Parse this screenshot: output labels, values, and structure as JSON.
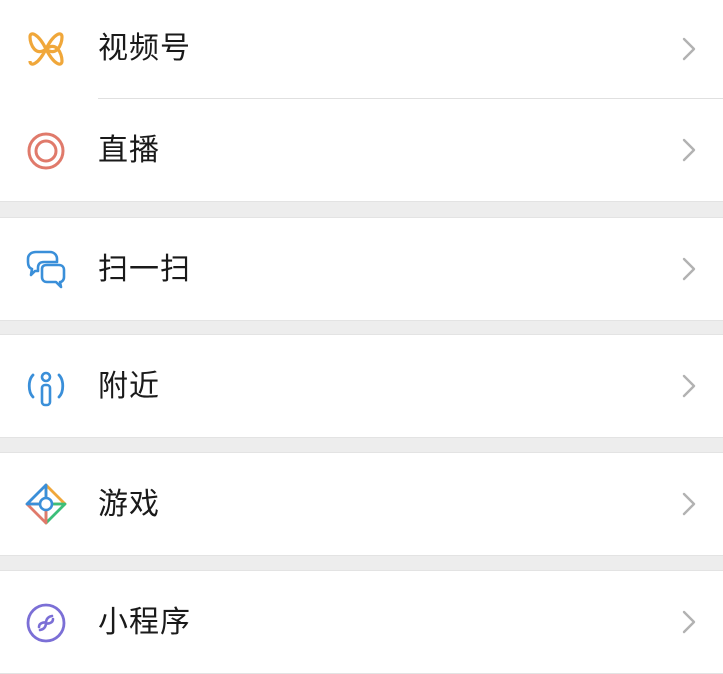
{
  "menu": {
    "channels": {
      "label": "视频号",
      "icon": "channels-icon",
      "color": "#f0a73a"
    },
    "live": {
      "label": "直播",
      "icon": "live-icon",
      "color": "#e07a6b"
    },
    "scan": {
      "label": "扫一扫",
      "icon": "scan-icon",
      "color": "#3a8fd9"
    },
    "nearby": {
      "label": "附近",
      "icon": "nearby-icon",
      "color": "#3a8fd9"
    },
    "games": {
      "label": "游戏",
      "icon": "games-icon"
    },
    "mini_programs": {
      "label": "小程序",
      "icon": "mini-program-icon",
      "color": "#7b6fd6"
    }
  },
  "colors": {
    "background": "#ededed",
    "row": "#ffffff",
    "chevron": "#b2b2b2",
    "text": "#1a1a1a"
  }
}
